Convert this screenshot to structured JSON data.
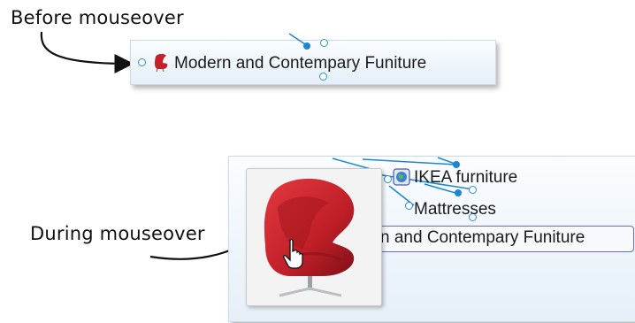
{
  "captions": {
    "before": "Before mouseover",
    "during": "During mouseover"
  },
  "before_panel": {
    "node_label": "Modern and Contempary Funiture",
    "node_icon": "armchair-icon"
  },
  "during_panel": {
    "node_ikea": "IKEA furniture",
    "node_mattresses": "Mattresses",
    "node_selected": "n and Contempary Funiture",
    "ikea_icon": "globe-icon",
    "preview_image": "red-egg-chair",
    "cursor_icon": "hand-pointer-icon"
  },
  "colors": {
    "connector": "#1d86d2",
    "chair_red": "#c8202a",
    "selection_border": "#6d6db8"
  }
}
